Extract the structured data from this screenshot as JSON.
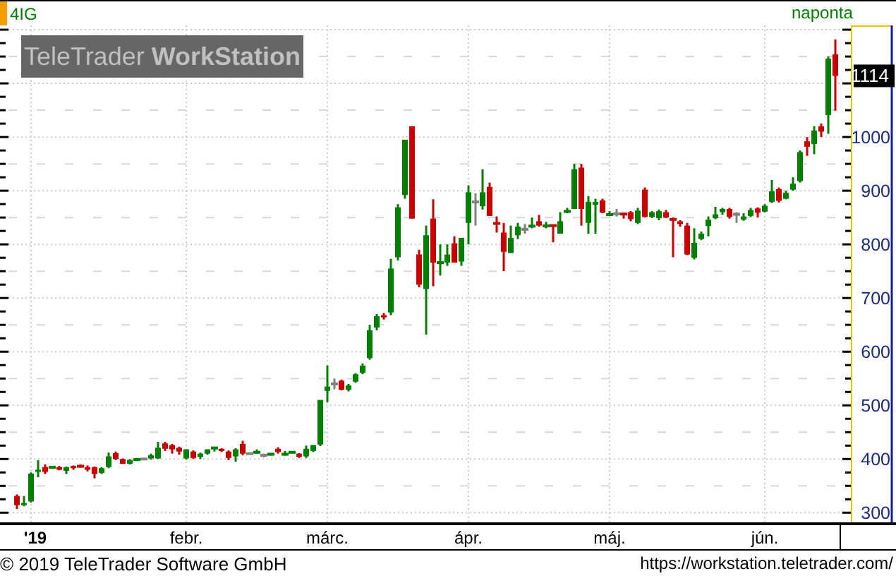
{
  "header": {
    "symbol": "4IG",
    "interval": "naponta"
  },
  "logo": "TeleTrader **WorkStation**",
  "chart": {
    "last_price_label": "1114",
    "chart_data": {
      "type": "candlestick",
      "grid": true,
      "ylim": [
        282,
        1208
      ],
      "yticks": [
        300,
        400,
        500,
        600,
        700,
        800,
        900,
        1000
      ],
      "categories": [
        null,
        null,
        "'19",
        null,
        null,
        null,
        null,
        null,
        null,
        null,
        null,
        null,
        null,
        null,
        null,
        null,
        null,
        null,
        null,
        null,
        null,
        null,
        null,
        null,
        "febr.",
        null,
        null,
        null,
        null,
        null,
        null,
        null,
        null,
        null,
        null,
        null,
        null,
        null,
        null,
        null,
        null,
        null,
        null,
        null,
        "márc.",
        null,
        null,
        null,
        null,
        null,
        null,
        null,
        null,
        null,
        null,
        null,
        null,
        null,
        null,
        null,
        null,
        null,
        null,
        null,
        "ápr.",
        null,
        null,
        null,
        null,
        null,
        null,
        null,
        null,
        null,
        null,
        null,
        null,
        null,
        null,
        null,
        null,
        null,
        null,
        null,
        "máj.",
        null,
        null,
        null,
        null,
        null,
        null,
        null,
        null,
        null,
        null,
        null,
        null,
        null,
        null,
        null,
        null,
        null,
        null,
        null,
        null,
        null,
        "jún.",
        null,
        null,
        null,
        null,
        null,
        null,
        null,
        null,
        null,
        null
      ],
      "ohlc": [
        [
          331,
          334,
          307,
          314
        ],
        [
          314,
          331,
          312,
          318
        ],
        [
          321,
          375,
          319,
          373
        ],
        [
          376,
          398,
          366,
          380
        ],
        [
          385,
          390,
          372,
          376
        ],
        [
          384,
          387,
          382,
          385
        ],
        [
          385,
          387,
          379,
          380
        ],
        [
          378,
          386,
          372,
          385
        ],
        [
          387,
          388,
          380,
          383
        ],
        [
          388,
          390,
          384,
          385
        ],
        [
          385,
          388,
          377,
          380
        ],
        [
          385,
          386,
          364,
          372
        ],
        [
          374,
          385,
          372,
          383
        ],
        [
          385,
          412,
          383,
          405
        ],
        [
          411,
          414,
          398,
          400
        ],
        [
          400,
          401,
          391,
          391
        ],
        [
          391,
          400,
          390,
          398
        ],
        [
          398,
          402,
          396,
          400
        ],
        [
          400,
          401,
          399,
          400
        ],
        [
          401,
          410,
          399,
          407
        ],
        [
          401,
          432,
          400,
          421
        ],
        [
          429,
          432,
          415,
          419
        ],
        [
          426,
          428,
          410,
          418
        ],
        [
          421,
          423,
          408,
          414
        ],
        [
          401,
          418,
          399,
          418
        ],
        [
          414,
          416,
          400,
          402
        ],
        [
          404,
          412,
          400,
          410
        ],
        [
          410,
          418,
          408,
          418
        ],
        [
          420,
          423,
          414,
          421
        ],
        [
          419,
          420,
          413,
          415
        ],
        [
          414,
          416,
          398,
          402
        ],
        [
          405,
          420,
          395,
          418
        ],
        [
          428,
          434,
          407,
          410
        ],
        [
          410,
          411,
          409,
          410
        ],
        [
          412,
          418,
          410,
          413
        ],
        [
          407,
          410,
          403,
          407
        ],
        [
          408,
          411,
          406,
          410
        ],
        [
          419,
          422,
          410,
          413
        ],
        [
          408,
          415,
          406,
          410
        ],
        [
          412,
          414,
          410,
          413
        ],
        [
          410,
          411,
          402,
          404
        ],
        [
          405,
          425,
          402,
          419
        ],
        [
          415,
          426,
          413,
          426
        ],
        [
          427,
          510,
          424,
          510
        ],
        [
          527,
          574,
          506,
          535
        ],
        [
          540,
          550,
          530,
          540
        ],
        [
          546,
          548,
          528,
          529
        ],
        [
          529,
          540,
          526,
          537
        ],
        [
          544,
          560,
          542,
          558
        ],
        [
          561,
          578,
          558,
          574
        ],
        [
          588,
          650,
          585,
          640
        ],
        [
          645,
          670,
          640,
          666
        ],
        [
          668,
          672,
          660,
          664
        ],
        [
          673,
          773,
          668,
          755
        ],
        [
          776,
          875,
          770,
          869
        ],
        [
          892,
          995,
          885,
          995
        ],
        [
          1020,
          1020,
          848,
          848
        ],
        [
          781,
          790,
          720,
          725
        ],
        [
          717,
          835,
          632,
          817
        ],
        [
          848,
          884,
          722,
          766
        ],
        [
          765,
          800,
          742,
          767
        ],
        [
          766,
          800,
          760,
          781
        ],
        [
          802,
          815,
          766,
          766
        ],
        [
          768,
          812,
          760,
          812
        ],
        [
          840,
          910,
          800,
          897
        ],
        [
          879,
          895,
          835,
          879
        ],
        [
          871,
          940,
          865,
          897
        ],
        [
          907,
          915,
          853,
          853
        ],
        [
          840,
          852,
          822,
          838
        ],
        [
          822,
          840,
          750,
          786
        ],
        [
          784,
          835,
          784,
          812
        ],
        [
          817,
          840,
          810,
          833
        ],
        [
          828,
          838,
          820,
          828
        ],
        [
          833,
          850,
          830,
          835
        ],
        [
          843,
          855,
          833,
          835
        ],
        [
          834,
          842,
          830,
          835
        ],
        [
          836,
          837,
          804,
          834
        ],
        [
          820,
          860,
          820,
          843
        ],
        [
          860,
          868,
          858,
          863
        ],
        [
          866,
          950,
          866,
          940
        ],
        [
          943,
          950,
          835,
          866
        ],
        [
          840,
          890,
          820,
          879
        ],
        [
          874,
          885,
          820,
          879
        ],
        [
          882,
          885,
          858,
          859
        ],
        [
          855,
          862,
          854,
          856
        ],
        [
          857,
          866,
          852,
          857
        ],
        [
          858,
          859,
          848,
          855
        ],
        [
          860,
          862,
          843,
          847
        ],
        [
          840,
          868,
          838,
          863
        ],
        [
          902,
          906,
          850,
          851
        ],
        [
          851,
          862,
          849,
          860
        ],
        [
          849,
          865,
          845,
          862
        ],
        [
          860,
          864,
          849,
          850
        ],
        [
          848,
          850,
          776,
          845
        ],
        [
          843,
          845,
          833,
          838
        ],
        [
          835,
          840,
          780,
          781
        ],
        [
          775,
          830,
          772,
          803
        ],
        [
          810,
          824,
          808,
          820
        ],
        [
          834,
          852,
          815,
          846
        ],
        [
          849,
          870,
          847,
          856
        ],
        [
          860,
          868,
          855,
          866
        ],
        [
          866,
          868,
          848,
          851
        ],
        [
          856,
          860,
          840,
          856
        ],
        [
          846,
          858,
          844,
          852
        ],
        [
          853,
          868,
          851,
          864
        ],
        [
          867,
          869,
          850,
          859
        ],
        [
          861,
          875,
          860,
          872
        ],
        [
          879,
          920,
          877,
          899
        ],
        [
          903,
          906,
          878,
          881
        ],
        [
          885,
          900,
          884,
          896
        ],
        [
          902,
          925,
          900,
          913
        ],
        [
          918,
          975,
          915,
          972
        ],
        [
          992,
          1000,
          965,
          982
        ],
        [
          987,
          1020,
          968,
          1012
        ],
        [
          1020,
          1025,
          1000,
          1010
        ],
        [
          1041,
          1150,
          1006,
          1146
        ],
        [
          1154,
          1182,
          1049,
          1114
        ]
      ]
    }
  },
  "footer": {
    "copyright": "© 2019 TeleTrader Software GmbH",
    "url": "https://workstation.teletrader.com/"
  }
}
